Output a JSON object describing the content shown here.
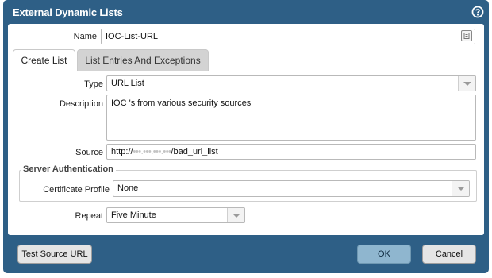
{
  "dialog": {
    "title": "External Dynamic Lists",
    "help_icon": "question-circle-icon"
  },
  "name_field": {
    "label": "Name",
    "value": "IOC-List-URL"
  },
  "tabs": [
    {
      "label": "Create List",
      "active": true
    },
    {
      "label": "List Entries And Exceptions",
      "active": false
    }
  ],
  "form": {
    "type": {
      "label": "Type",
      "value": "URL List"
    },
    "description": {
      "label": "Description",
      "value": "IOC 's from various security sources"
    },
    "source": {
      "label": "Source",
      "prefix": "http://",
      "masked": "•••.•••.•••.•••",
      "suffix": "/bad_url_list"
    },
    "server_auth": {
      "legend": "Server Authentication",
      "certificate_profile": {
        "label": "Certificate Profile",
        "value": "None"
      }
    },
    "repeat": {
      "label": "Repeat",
      "value": "Five Minute"
    }
  },
  "footer": {
    "test_button": "Test Source URL",
    "ok_button": "OK",
    "cancel_button": "Cancel"
  },
  "colors": {
    "dialog_bg": "#2e5f86",
    "ok_button": "#8fb6cf"
  }
}
